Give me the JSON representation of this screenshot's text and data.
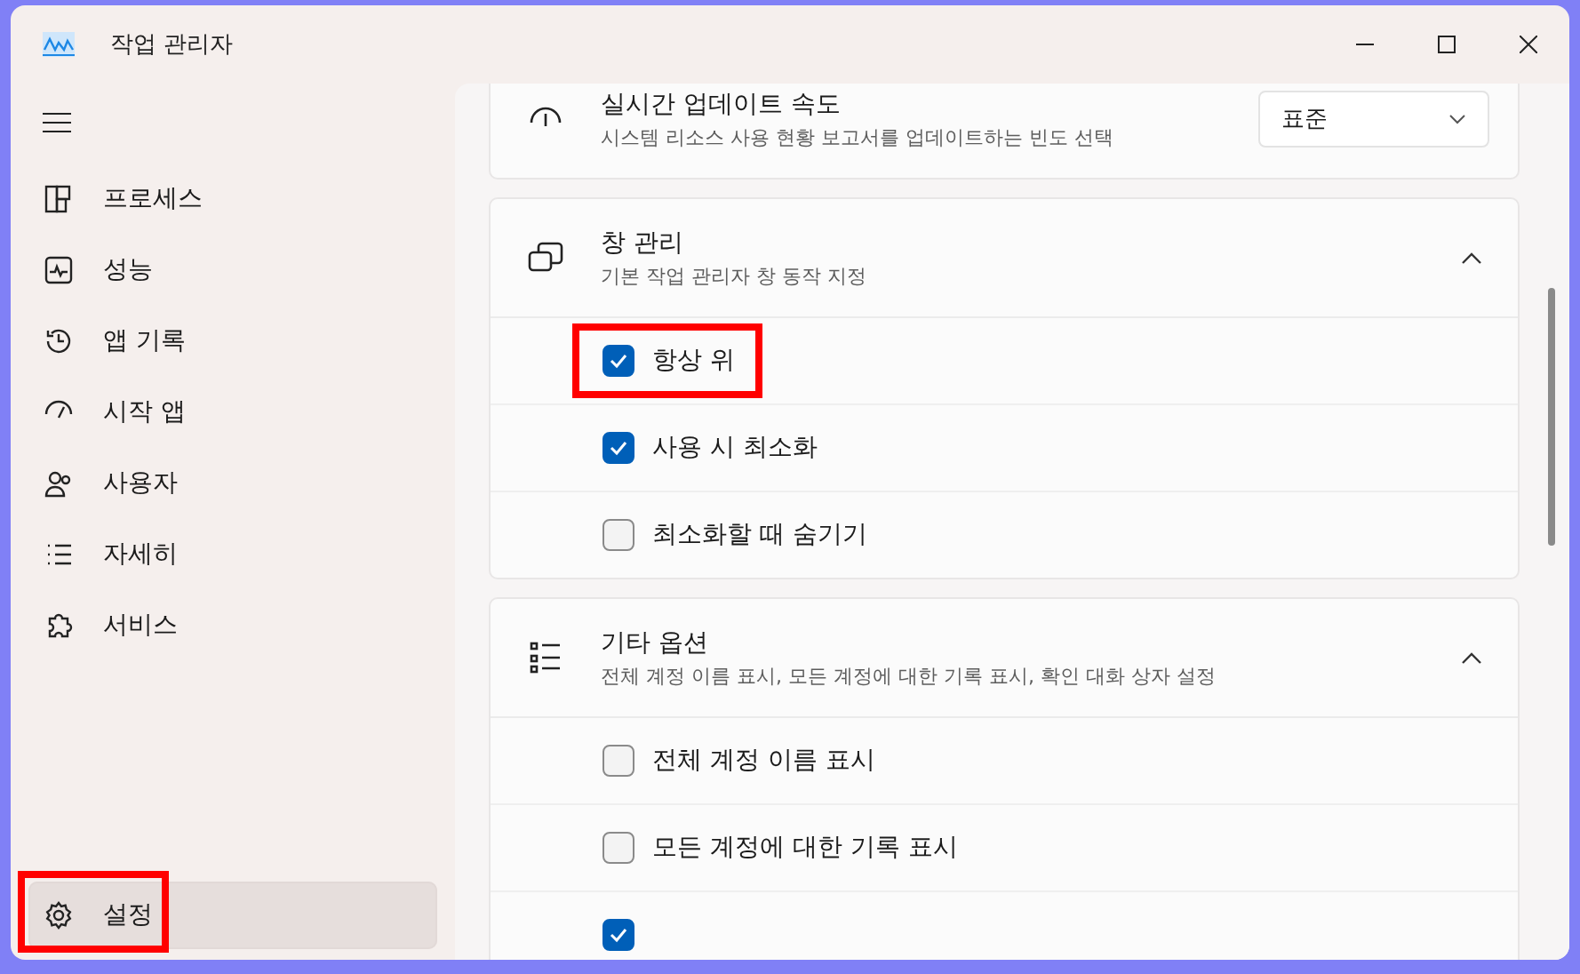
{
  "window": {
    "title": "작업 관리자"
  },
  "sidebar": {
    "items": [
      {
        "kind": "processes",
        "label": "프로세스",
        "selected": false
      },
      {
        "kind": "performance",
        "label": "성능",
        "selected": false
      },
      {
        "kind": "history",
        "label": "앱 기록",
        "selected": false
      },
      {
        "kind": "startup",
        "label": "시작 앱",
        "selected": false
      },
      {
        "kind": "users",
        "label": "사용자",
        "selected": false
      },
      {
        "kind": "details",
        "label": "자세히",
        "selected": false
      },
      {
        "kind": "services",
        "label": "서비스",
        "selected": false
      }
    ],
    "settings": {
      "label": "설정",
      "selected": true,
      "highlighted": true
    }
  },
  "sections": [
    {
      "kind": "dropdown",
      "title": "실시간 업데이트 속도",
      "subtitle": "시스템 리소스 사용 현황 보고서를 업데이트하는 빈도 선택",
      "value": "표준"
    },
    {
      "kind": "group",
      "title": "창 관리",
      "subtitle": "기본 작업 관리자 창 동작 지정",
      "expanded": true,
      "options": [
        {
          "label": "항상 위",
          "checked": true,
          "highlighted": true
        },
        {
          "label": "사용 시 최소화",
          "checked": true,
          "highlighted": false
        },
        {
          "label": "최소화할 때 숨기기",
          "checked": false,
          "highlighted": false
        }
      ]
    },
    {
      "kind": "group",
      "title": "기타 옵션",
      "subtitle": "전체 계정 이름 표시, 모든 계정에 대한 기록 표시, 확인 대화 상자 설정",
      "expanded": true,
      "options": [
        {
          "label": "전체 계정 이름 표시",
          "checked": false,
          "highlighted": false
        },
        {
          "label": "모든 계정에 대한 기록 표시",
          "checked": false,
          "highlighted": false
        },
        {
          "checked": true,
          "highlighted": false
        }
      ]
    }
  ]
}
